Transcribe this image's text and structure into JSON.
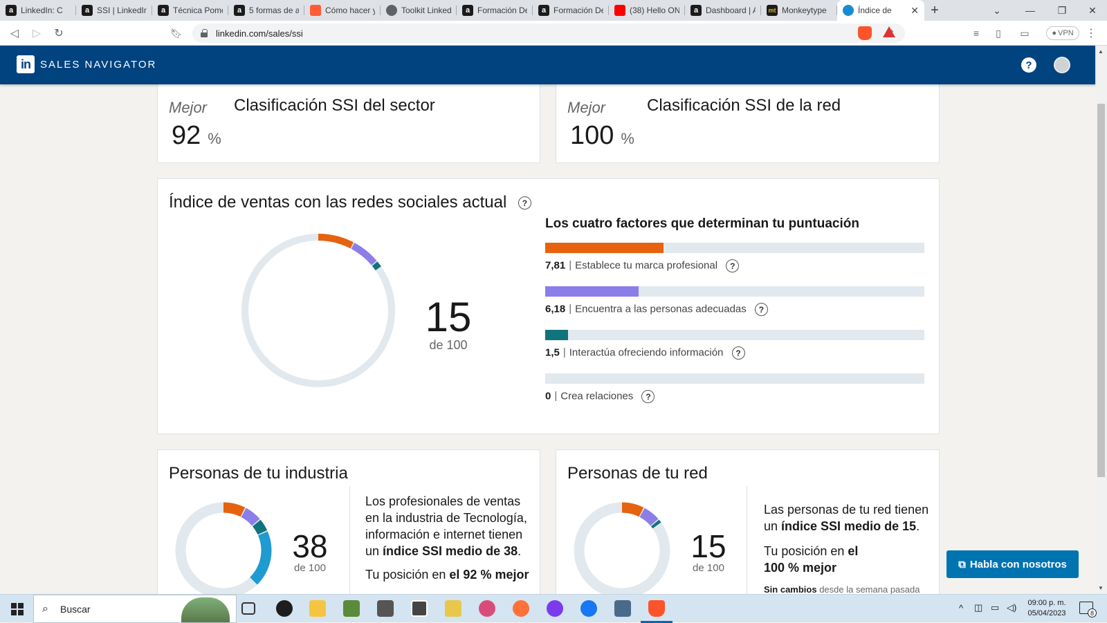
{
  "browser": {
    "tabs": [
      {
        "label": "LinkedIn: C",
        "icon": "a"
      },
      {
        "label": "SSI | LinkedIn",
        "icon": "a"
      },
      {
        "label": "Técnica Pomo",
        "icon": "a"
      },
      {
        "label": "5 formas de a",
        "icon": "a"
      },
      {
        "label": "Cómo hacer y",
        "icon": "hubspot"
      },
      {
        "label": "Toolkit Linked",
        "icon": "globe"
      },
      {
        "label": "Formación De",
        "icon": "a"
      },
      {
        "label": "Formación De",
        "icon": "a"
      },
      {
        "label": "(38) Hello ON",
        "icon": "youtube"
      },
      {
        "label": "Dashboard | A",
        "icon": "a"
      },
      {
        "label": "Monkeytype",
        "icon": "mt"
      },
      {
        "label": "Índice de",
        "icon": "compass",
        "active": true
      }
    ],
    "url": "linkedin.com/sales/ssi",
    "vpn_label": "VPN"
  },
  "header": {
    "logo_text": "in",
    "brand": "SALES NAVIGATOR",
    "help_icon": "question-icon"
  },
  "sector_card": {
    "best_label": "Mejor",
    "value": "92",
    "unit": "%",
    "title": "Clasificación SSI del sector"
  },
  "network_card": {
    "best_label": "Mejor",
    "value": "100",
    "unit": "%",
    "title": "Clasificación SSI de la red"
  },
  "ssi": {
    "title": "Índice de ventas con las redes sociales actual",
    "score": "15",
    "out_of": "de 100",
    "factors_title": "Los cuatro factores que determinan tu puntuación",
    "factors": [
      {
        "value": "7,81",
        "label": "Establece tu marca profesional",
        "max": 25,
        "color": "#e7620e"
      },
      {
        "value": "6,18",
        "label": "Encuentra a las personas adecuadas",
        "max": 25,
        "color": "#8c7ee8"
      },
      {
        "value": "1,5",
        "label": "Interactúa ofreciendo información",
        "max": 25,
        "color": "#10747d"
      },
      {
        "value": "0",
        "label": "Crea relaciones",
        "max": 25,
        "color": "#1f9bd1"
      }
    ],
    "separator": "|"
  },
  "industry": {
    "title": "Personas de tu industria",
    "score": "38",
    "out_of": "de 100",
    "segments": [
      7.8,
      6.2,
      4.5,
      19.5
    ],
    "text_1": "Los profesionales de ventas en la industria de Tecnología, información e internet tienen un ",
    "text_1_bold": "índice SSI medio de 38",
    "text_1_end": ".",
    "text_2": "Tu posición en ",
    "text_2_bold": "el 92 % mejor"
  },
  "network": {
    "title": "Personas de tu red",
    "score": "15",
    "out_of": "de 100",
    "segments": [
      7.81,
      6.18,
      1.5,
      0
    ],
    "text_1": "Las personas de tu red tienen un ",
    "text_1_bold": "índice SSI medio de 15",
    "text_1_end": ".",
    "text_2": "Tu posición en ",
    "text_2_bold": "el 100 % mejor",
    "change_bold": "Sin cambios",
    "change_text": " desde la semana pasada"
  },
  "chat_button": "Habla con nosotros",
  "taskbar": {
    "search_placeholder": "Buscar",
    "time": "09:00 p. m.",
    "date": "05/04/2023",
    "notifications": "8"
  }
}
